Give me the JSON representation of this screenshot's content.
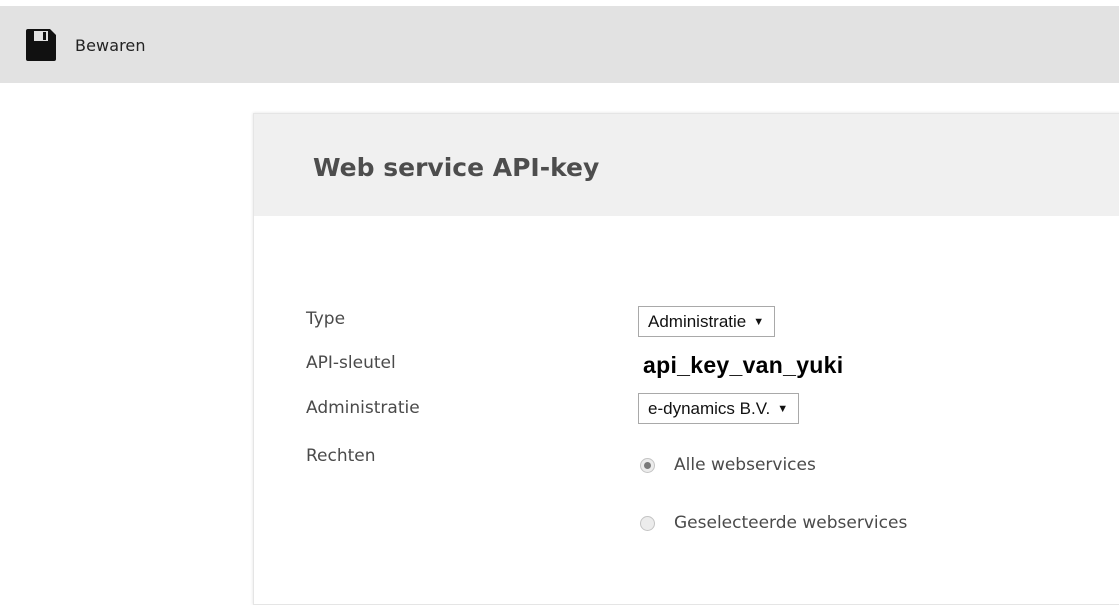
{
  "toolbar": {
    "save_label": "Bewaren",
    "save_icon": "floppy-disk-icon"
  },
  "panel": {
    "title": "Web service API-key"
  },
  "form": {
    "type_label": "Type",
    "type_value": "Administratie",
    "api_key_label": "API-sleutel",
    "api_key_value": "api_key_van_yuki",
    "administratie_label": "Administratie",
    "administratie_value": "e-dynamics B.V.",
    "rechten_label": "Rechten",
    "rechten_options": [
      {
        "label": "Alle webservices",
        "checked": true
      },
      {
        "label": "Geselecteerde webservices",
        "checked": false
      }
    ]
  }
}
